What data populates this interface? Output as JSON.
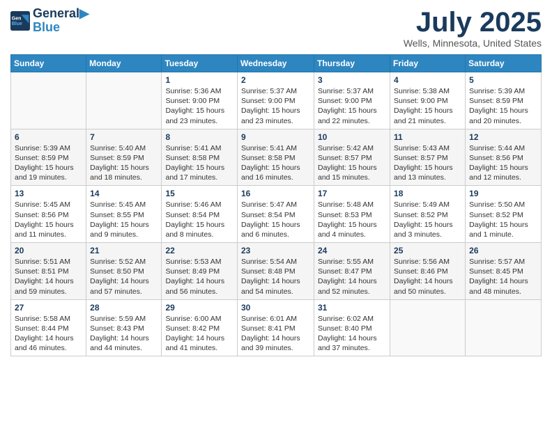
{
  "logo": {
    "line1": "General",
    "line2": "Blue"
  },
  "title": "July 2025",
  "subtitle": "Wells, Minnesota, United States",
  "days_of_week": [
    "Sunday",
    "Monday",
    "Tuesday",
    "Wednesday",
    "Thursday",
    "Friday",
    "Saturday"
  ],
  "weeks": [
    [
      {
        "num": "",
        "info": ""
      },
      {
        "num": "",
        "info": ""
      },
      {
        "num": "1",
        "info": "Sunrise: 5:36 AM\nSunset: 9:00 PM\nDaylight: 15 hours\nand 23 minutes."
      },
      {
        "num": "2",
        "info": "Sunrise: 5:37 AM\nSunset: 9:00 PM\nDaylight: 15 hours\nand 23 minutes."
      },
      {
        "num": "3",
        "info": "Sunrise: 5:37 AM\nSunset: 9:00 PM\nDaylight: 15 hours\nand 22 minutes."
      },
      {
        "num": "4",
        "info": "Sunrise: 5:38 AM\nSunset: 9:00 PM\nDaylight: 15 hours\nand 21 minutes."
      },
      {
        "num": "5",
        "info": "Sunrise: 5:39 AM\nSunset: 8:59 PM\nDaylight: 15 hours\nand 20 minutes."
      }
    ],
    [
      {
        "num": "6",
        "info": "Sunrise: 5:39 AM\nSunset: 8:59 PM\nDaylight: 15 hours\nand 19 minutes."
      },
      {
        "num": "7",
        "info": "Sunrise: 5:40 AM\nSunset: 8:59 PM\nDaylight: 15 hours\nand 18 minutes."
      },
      {
        "num": "8",
        "info": "Sunrise: 5:41 AM\nSunset: 8:58 PM\nDaylight: 15 hours\nand 17 minutes."
      },
      {
        "num": "9",
        "info": "Sunrise: 5:41 AM\nSunset: 8:58 PM\nDaylight: 15 hours\nand 16 minutes."
      },
      {
        "num": "10",
        "info": "Sunrise: 5:42 AM\nSunset: 8:57 PM\nDaylight: 15 hours\nand 15 minutes."
      },
      {
        "num": "11",
        "info": "Sunrise: 5:43 AM\nSunset: 8:57 PM\nDaylight: 15 hours\nand 13 minutes."
      },
      {
        "num": "12",
        "info": "Sunrise: 5:44 AM\nSunset: 8:56 PM\nDaylight: 15 hours\nand 12 minutes."
      }
    ],
    [
      {
        "num": "13",
        "info": "Sunrise: 5:45 AM\nSunset: 8:56 PM\nDaylight: 15 hours\nand 11 minutes."
      },
      {
        "num": "14",
        "info": "Sunrise: 5:45 AM\nSunset: 8:55 PM\nDaylight: 15 hours\nand 9 minutes."
      },
      {
        "num": "15",
        "info": "Sunrise: 5:46 AM\nSunset: 8:54 PM\nDaylight: 15 hours\nand 8 minutes."
      },
      {
        "num": "16",
        "info": "Sunrise: 5:47 AM\nSunset: 8:54 PM\nDaylight: 15 hours\nand 6 minutes."
      },
      {
        "num": "17",
        "info": "Sunrise: 5:48 AM\nSunset: 8:53 PM\nDaylight: 15 hours\nand 4 minutes."
      },
      {
        "num": "18",
        "info": "Sunrise: 5:49 AM\nSunset: 8:52 PM\nDaylight: 15 hours\nand 3 minutes."
      },
      {
        "num": "19",
        "info": "Sunrise: 5:50 AM\nSunset: 8:52 PM\nDaylight: 15 hours\nand 1 minute."
      }
    ],
    [
      {
        "num": "20",
        "info": "Sunrise: 5:51 AM\nSunset: 8:51 PM\nDaylight: 14 hours\nand 59 minutes."
      },
      {
        "num": "21",
        "info": "Sunrise: 5:52 AM\nSunset: 8:50 PM\nDaylight: 14 hours\nand 57 minutes."
      },
      {
        "num": "22",
        "info": "Sunrise: 5:53 AM\nSunset: 8:49 PM\nDaylight: 14 hours\nand 56 minutes."
      },
      {
        "num": "23",
        "info": "Sunrise: 5:54 AM\nSunset: 8:48 PM\nDaylight: 14 hours\nand 54 minutes."
      },
      {
        "num": "24",
        "info": "Sunrise: 5:55 AM\nSunset: 8:47 PM\nDaylight: 14 hours\nand 52 minutes."
      },
      {
        "num": "25",
        "info": "Sunrise: 5:56 AM\nSunset: 8:46 PM\nDaylight: 14 hours\nand 50 minutes."
      },
      {
        "num": "26",
        "info": "Sunrise: 5:57 AM\nSunset: 8:45 PM\nDaylight: 14 hours\nand 48 minutes."
      }
    ],
    [
      {
        "num": "27",
        "info": "Sunrise: 5:58 AM\nSunset: 8:44 PM\nDaylight: 14 hours\nand 46 minutes."
      },
      {
        "num": "28",
        "info": "Sunrise: 5:59 AM\nSunset: 8:43 PM\nDaylight: 14 hours\nand 44 minutes."
      },
      {
        "num": "29",
        "info": "Sunrise: 6:00 AM\nSunset: 8:42 PM\nDaylight: 14 hours\nand 41 minutes."
      },
      {
        "num": "30",
        "info": "Sunrise: 6:01 AM\nSunset: 8:41 PM\nDaylight: 14 hours\nand 39 minutes."
      },
      {
        "num": "31",
        "info": "Sunrise: 6:02 AM\nSunset: 8:40 PM\nDaylight: 14 hours\nand 37 minutes."
      },
      {
        "num": "",
        "info": ""
      },
      {
        "num": "",
        "info": ""
      }
    ]
  ]
}
